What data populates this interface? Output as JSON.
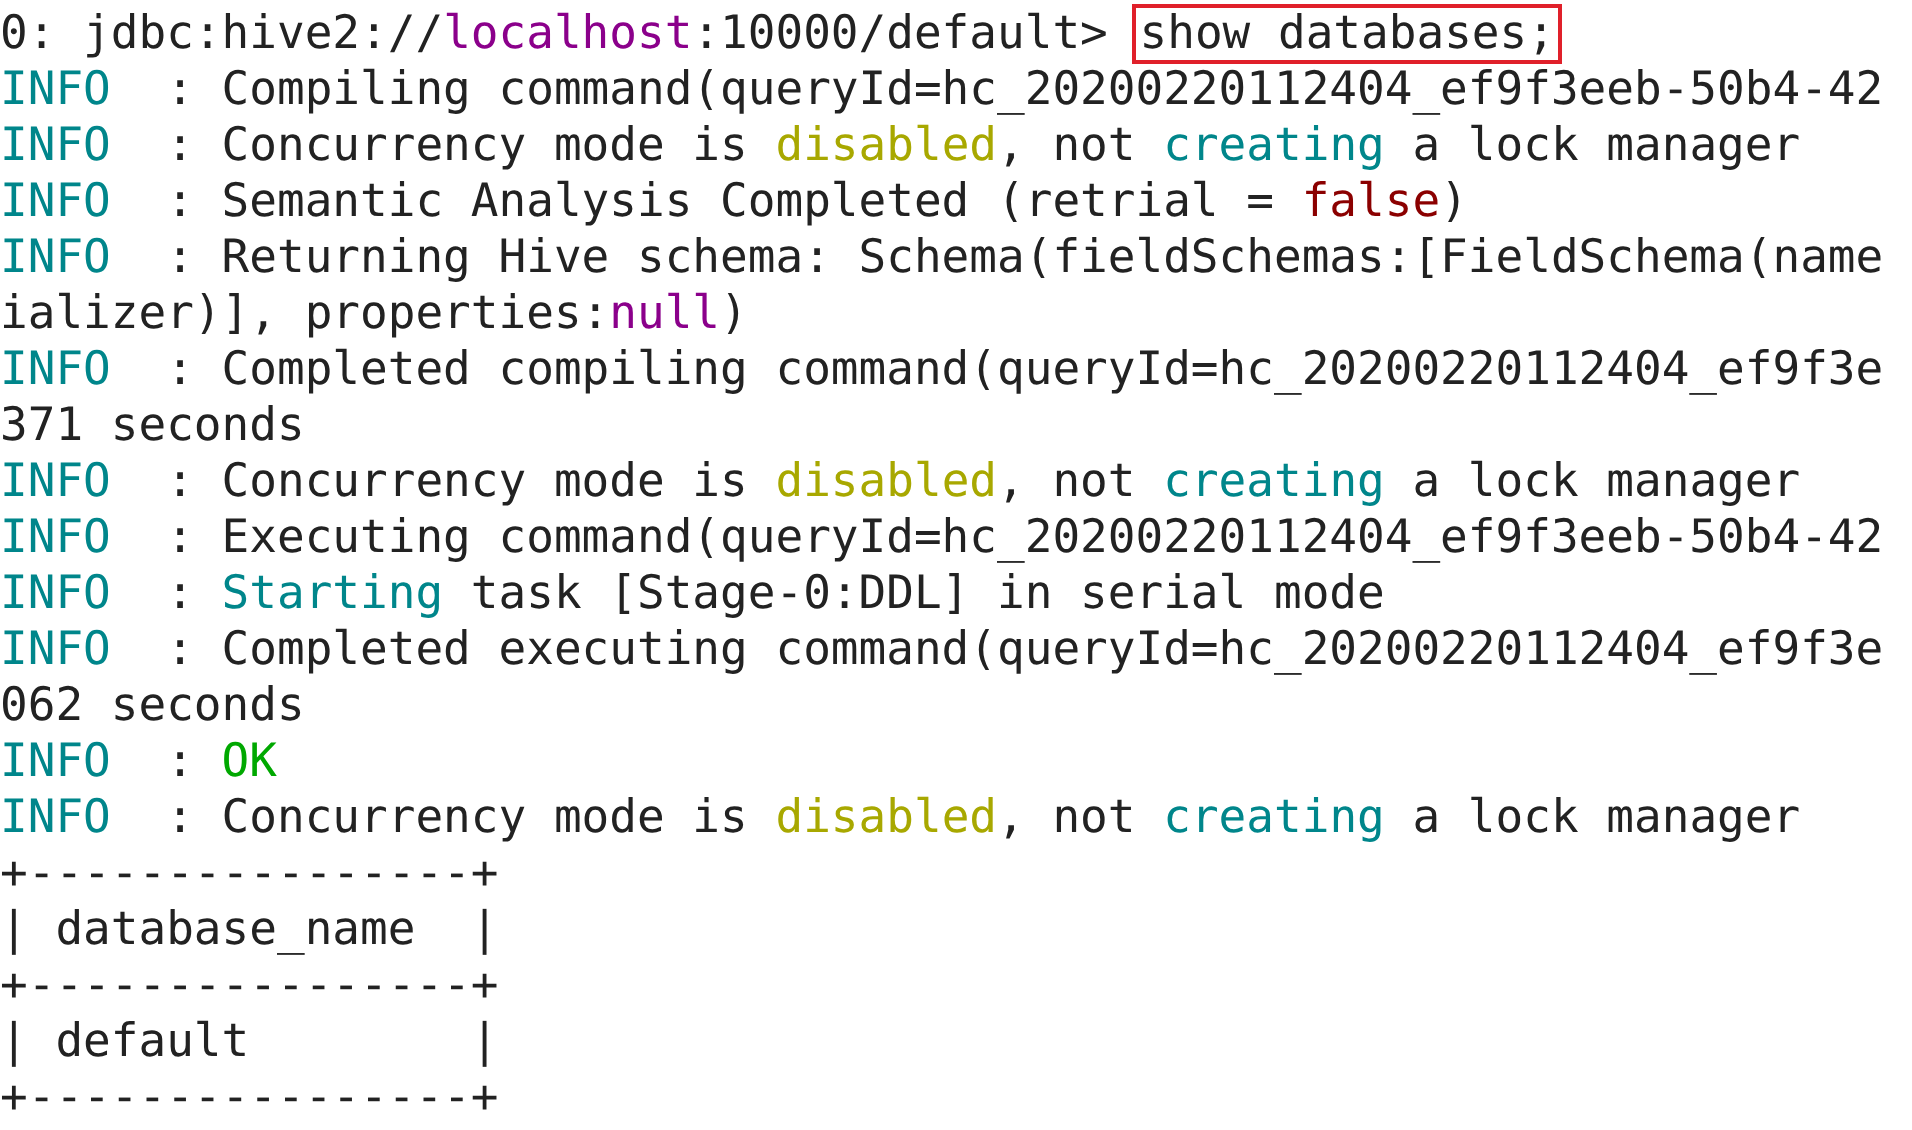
{
  "terminal": {
    "lines": [
      {
        "segments": [
          {
            "kind": "text",
            "text": "0: jdbc:hive2://"
          },
          {
            "kind": "host",
            "text": "localhost"
          },
          {
            "kind": "text",
            "text": ":10000/default> "
          },
          {
            "kind": "boxed",
            "text": "show databases;"
          }
        ]
      },
      {
        "segments": [
          {
            "kind": "level",
            "text": "INFO"
          },
          {
            "kind": "text",
            "text": "  : Compiling command(queryId=hc_20200220112404_ef9f3eeb-50b4-42"
          }
        ]
      },
      {
        "segments": [
          {
            "kind": "level",
            "text": "INFO"
          },
          {
            "kind": "text",
            "text": "  : Concurrency mode is "
          },
          {
            "kind": "warn",
            "text": "disabled"
          },
          {
            "kind": "text",
            "text": ", not "
          },
          {
            "kind": "action",
            "text": "creating"
          },
          {
            "kind": "text",
            "text": " a lock manager"
          }
        ]
      },
      {
        "segments": [
          {
            "kind": "level",
            "text": "INFO"
          },
          {
            "kind": "text",
            "text": "  : Semantic Analysis Completed (retrial = "
          },
          {
            "kind": "literal",
            "text": "false"
          },
          {
            "kind": "text",
            "text": ")"
          }
        ]
      },
      {
        "segments": [
          {
            "kind": "level",
            "text": "INFO"
          },
          {
            "kind": "text",
            "text": "  : Returning Hive schema: Schema(fieldSchemas:[FieldSchema(name"
          }
        ]
      },
      {
        "segments": [
          {
            "kind": "text",
            "text": "ializer)], properties:"
          },
          {
            "kind": "host",
            "text": "null"
          },
          {
            "kind": "text",
            "text": ")"
          }
        ]
      },
      {
        "segments": [
          {
            "kind": "level",
            "text": "INFO"
          },
          {
            "kind": "text",
            "text": "  : Completed compiling command(queryId=hc_20200220112404_ef9f3e"
          }
        ]
      },
      {
        "segments": [
          {
            "kind": "text",
            "text": "371 seconds"
          }
        ]
      },
      {
        "segments": [
          {
            "kind": "level",
            "text": "INFO"
          },
          {
            "kind": "text",
            "text": "  : Concurrency mode is "
          },
          {
            "kind": "warn",
            "text": "disabled"
          },
          {
            "kind": "text",
            "text": ", not "
          },
          {
            "kind": "action",
            "text": "creating"
          },
          {
            "kind": "text",
            "text": " a lock manager"
          }
        ]
      },
      {
        "segments": [
          {
            "kind": "level",
            "text": "INFO"
          },
          {
            "kind": "text",
            "text": "  : Executing command(queryId=hc_20200220112404_ef9f3eeb-50b4-42"
          }
        ]
      },
      {
        "segments": [
          {
            "kind": "level",
            "text": "INFO"
          },
          {
            "kind": "text",
            "text": "  : "
          },
          {
            "kind": "action",
            "text": "Starting"
          },
          {
            "kind": "text",
            "text": " task [Stage-0:DDL] in serial mode"
          }
        ]
      },
      {
        "segments": [
          {
            "kind": "level",
            "text": "INFO"
          },
          {
            "kind": "text",
            "text": "  : Completed executing command(queryId=hc_20200220112404_ef9f3e"
          }
        ]
      },
      {
        "segments": [
          {
            "kind": "text",
            "text": "062 seconds"
          }
        ]
      },
      {
        "segments": [
          {
            "kind": "level",
            "text": "INFO"
          },
          {
            "kind": "text",
            "text": "  : "
          },
          {
            "kind": "ok",
            "text": "OK"
          }
        ]
      },
      {
        "segments": [
          {
            "kind": "level",
            "text": "INFO"
          },
          {
            "kind": "text",
            "text": "  : Concurrency mode is "
          },
          {
            "kind": "warn",
            "text": "disabled"
          },
          {
            "kind": "text",
            "text": ", not "
          },
          {
            "kind": "action",
            "text": "creating"
          },
          {
            "kind": "text",
            "text": " a lock manager"
          }
        ]
      },
      {
        "segments": [
          {
            "kind": "text",
            "text": "+----------------+"
          }
        ]
      },
      {
        "segments": [
          {
            "kind": "text",
            "text": "| database_name  |"
          }
        ]
      },
      {
        "segments": [
          {
            "kind": "text",
            "text": "+----------------+"
          }
        ]
      },
      {
        "segments": [
          {
            "kind": "text",
            "text": "| default        |"
          }
        ]
      },
      {
        "segments": [
          {
            "kind": "text",
            "text": "+----------------+"
          }
        ]
      }
    ]
  }
}
